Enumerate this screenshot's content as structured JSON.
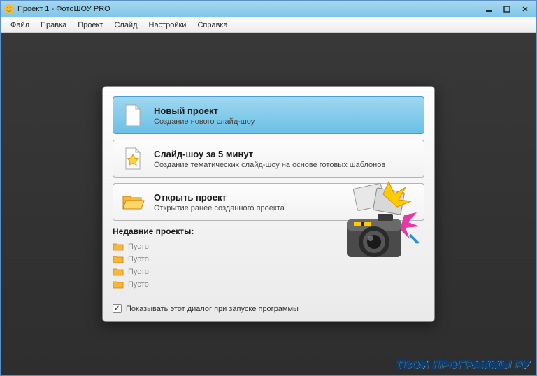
{
  "window": {
    "title": "Проект 1 - ФотоШОУ PRO"
  },
  "menubar": {
    "items": [
      "Файл",
      "Правка",
      "Проект",
      "Слайд",
      "Настройки",
      "Справка"
    ]
  },
  "dialog": {
    "options": [
      {
        "title": "Новый проект",
        "desc": "Создание нового слайд-шоу",
        "selected": true
      },
      {
        "title": "Слайд-шоу за 5 минут",
        "desc": "Создание тематических слайд-шоу на основе готовых шаблонов",
        "selected": false
      },
      {
        "title": "Открыть проект",
        "desc": "Открытие ранее созданного проекта",
        "selected": false
      }
    ],
    "recent": {
      "heading": "Недавние проекты:",
      "items": [
        "Пусто",
        "Пусто",
        "Пусто",
        "Пусто"
      ]
    },
    "checkbox": {
      "checked": true,
      "label": "Показывать этот диалог при запуске программы"
    }
  },
  "watermark": "ТВОИ ПРОГРАММЫ РУ"
}
